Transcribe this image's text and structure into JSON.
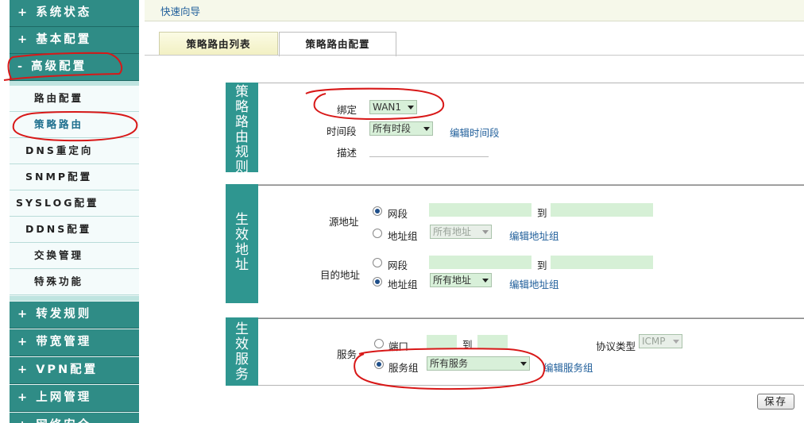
{
  "sidebar": {
    "top_items": [
      {
        "label": "+ 系统状态"
      },
      {
        "label": "+ 基本配置"
      },
      {
        "label": "- 高级配置"
      }
    ],
    "sub_items": [
      {
        "label": "路由配置"
      },
      {
        "label": "策略路由"
      },
      {
        "label": "DNS重定向"
      },
      {
        "label": "SNMP配置"
      },
      {
        "label": "SYSLOG配置"
      },
      {
        "label": "DDNS配置"
      },
      {
        "label": "交换管理"
      },
      {
        "label": "特殊功能"
      }
    ],
    "bottom_items": [
      {
        "label": "+ 转发规则"
      },
      {
        "label": "+ 带宽管理"
      },
      {
        "label": "+ VPN配置"
      },
      {
        "label": "+ 上网管理"
      },
      {
        "label": "+ 网络安全"
      }
    ]
  },
  "topbar": {
    "quick_link": "快速向导"
  },
  "tabs": [
    {
      "label": "策略路由列表"
    },
    {
      "label": "策略路由配置"
    }
  ],
  "rule_section": {
    "title": [
      "策",
      "略",
      "路",
      "由",
      "规",
      "则"
    ],
    "bind_label": "绑定",
    "bind_value": "WAN1",
    "time_label": "时间段",
    "time_value": "所有时段",
    "edit_time_link": "编辑时间段",
    "desc_label": "描述"
  },
  "address_section": {
    "title": [
      "生",
      "效",
      "地",
      "址"
    ],
    "src_label": "源地址",
    "src_segment_label": "网段",
    "src_to": "到",
    "src_group_label": "地址组",
    "src_group_value": "所有地址",
    "src_edit_link": "编辑地址组",
    "dst_label": "目的地址",
    "dst_segment_label": "网段",
    "dst_to": "到",
    "dst_group_label": "地址组",
    "dst_group_value": "所有地址",
    "dst_edit_link": "编辑地址组"
  },
  "service_section": {
    "title": [
      "生",
      "效",
      "服",
      "务"
    ],
    "service_label": "服务",
    "port_label": "端口",
    "port_to": "到",
    "protocol_label": "协议类型",
    "protocol_value": "ICMP",
    "group_label": "服务组",
    "group_value": "所有服务",
    "edit_group_link": "编辑服务组"
  },
  "save_button": "保存",
  "colors": {
    "sidebar_accent": "#2f8c86",
    "section_accent": "#2f9690",
    "field_bg": "#d6f0d6",
    "link": "#1f5e9a",
    "annotation": "#d81818"
  }
}
